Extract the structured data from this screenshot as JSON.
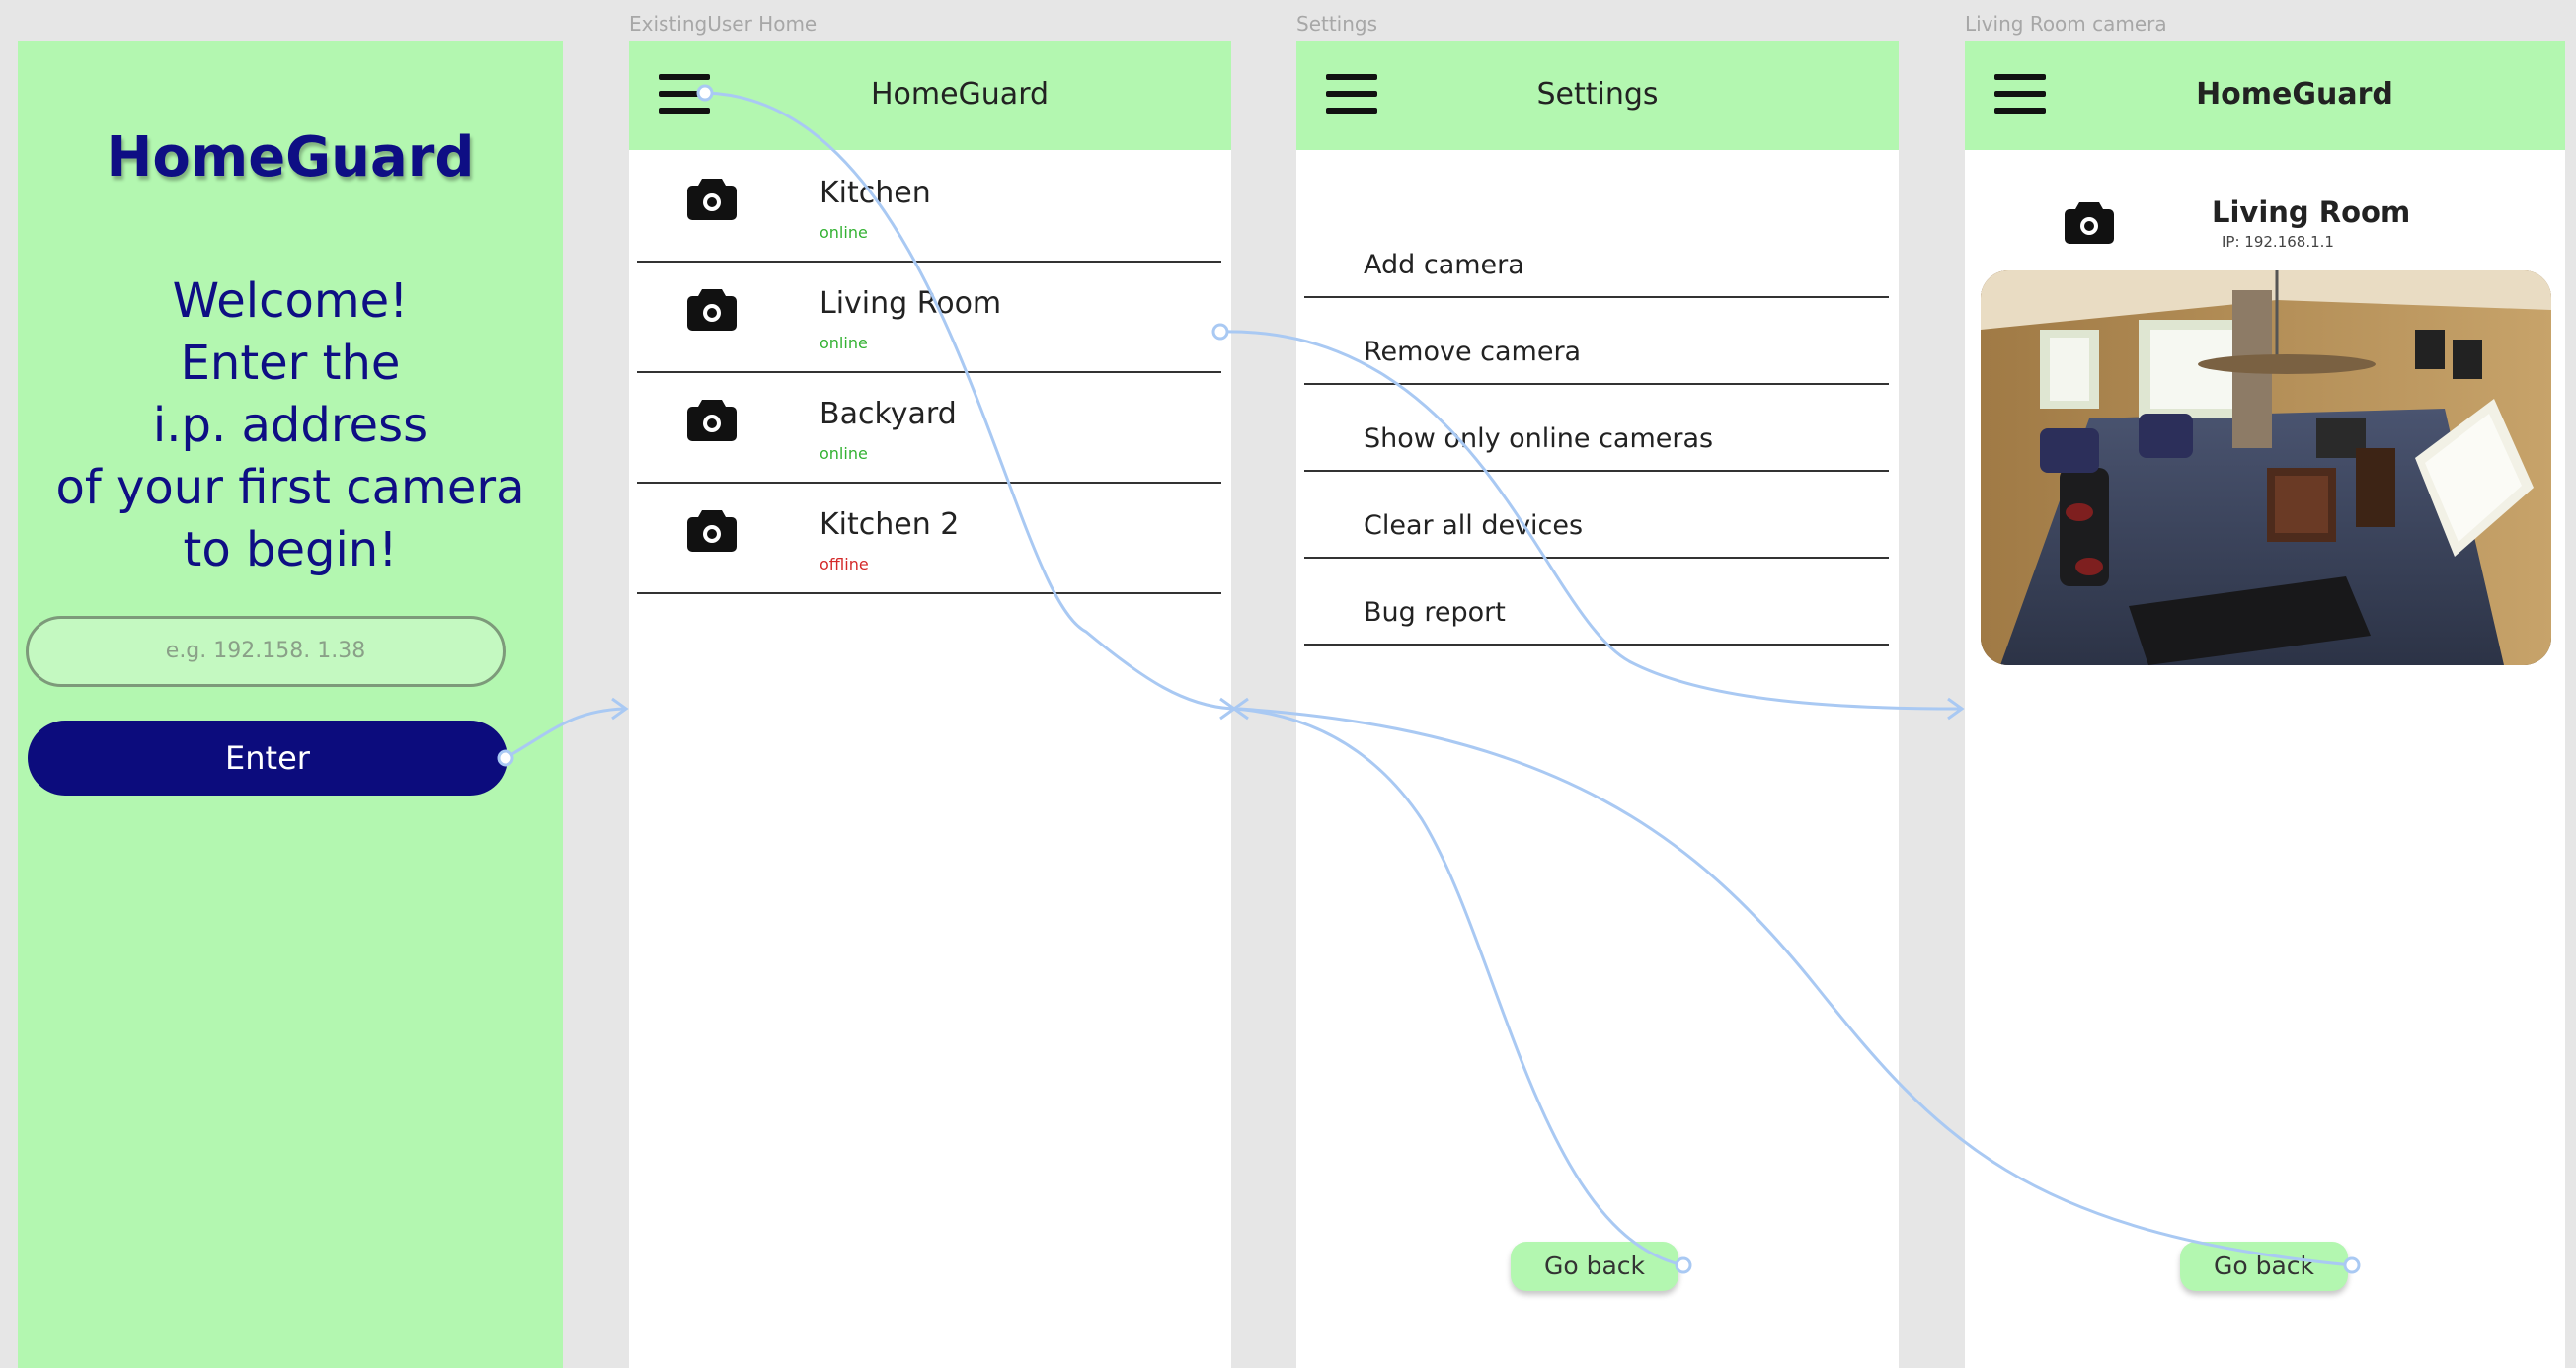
{
  "frames": {
    "home": "ExistingUser Home",
    "settings": "Settings",
    "camera": "Living Room camera"
  },
  "welcome": {
    "brand": "HomeGuard",
    "lines": [
      "Welcome!",
      "Enter the",
      "i.p. address",
      "of your first camera",
      "to begin!"
    ],
    "ip_placeholder": "e.g. 192.158. 1.38",
    "enter_label": "Enter"
  },
  "home": {
    "title": "HomeGuard",
    "cameras": [
      {
        "name": "Kitchen",
        "status": "online"
      },
      {
        "name": "Living Room",
        "status": "online"
      },
      {
        "name": "Backyard",
        "status": "online"
      },
      {
        "name": "Kitchen 2",
        "status": "offline"
      }
    ]
  },
  "settings": {
    "title": "Settings",
    "items": [
      "Add camera",
      "Remove camera",
      "Show only online cameras",
      "Clear all devices",
      "Bug report"
    ],
    "go_back": "Go back"
  },
  "camera_view": {
    "title": "HomeGuard",
    "name": "Living Room",
    "ip": "IP: 192.168.1.1",
    "go_back": "Go back"
  },
  "colors": {
    "mint": "#b3f7b0",
    "navy": "#0e0e84",
    "online": "#34b233",
    "offline": "#d42a2a",
    "flow": "#a9c9f3"
  },
  "icons": {
    "menu": "menu-icon",
    "camera": "camera-icon"
  }
}
